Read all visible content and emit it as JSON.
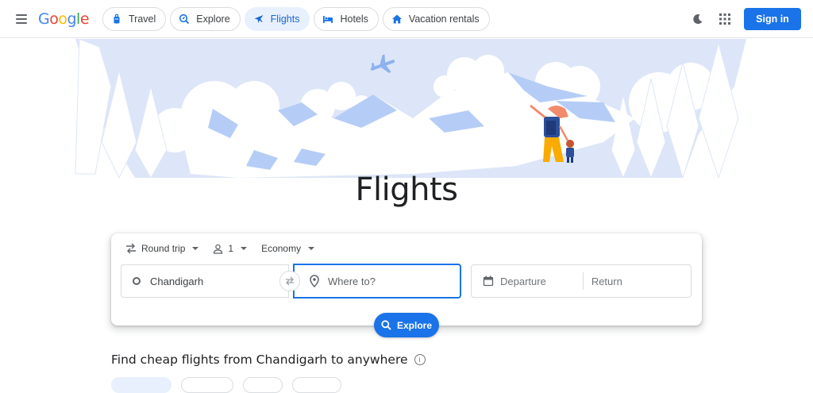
{
  "header": {
    "logo": {
      "letters": [
        "G",
        "o",
        "o",
        "g",
        "l",
        "e"
      ],
      "colors": [
        "#4285F4",
        "#EA4335",
        "#FBBC05",
        "#4285F4",
        "#34A853",
        "#EA4335"
      ]
    },
    "tabs": [
      {
        "label": "Travel",
        "icon": "suitcase-icon",
        "active": false
      },
      {
        "label": "Explore",
        "icon": "explore-icon",
        "active": false
      },
      {
        "label": "Flights",
        "icon": "plane-icon",
        "active": true
      },
      {
        "label": "Hotels",
        "icon": "bed-icon",
        "active": false
      },
      {
        "label": "Vacation rentals",
        "icon": "house-icon",
        "active": false
      }
    ],
    "signin_label": "Sign in"
  },
  "page": {
    "title": "Flights"
  },
  "search": {
    "trip_type": "Round trip",
    "passengers": "1",
    "cabin_class": "Economy",
    "from_value": "Chandigarh",
    "to_placeholder": "Where to?",
    "departure_placeholder": "Departure",
    "return_placeholder": "Return",
    "explore_label": "Explore"
  },
  "section": {
    "heading": "Find cheap flights from Chandigarh to anywhere",
    "info_glyph": "i"
  },
  "colors": {
    "accent": "#1a73e8",
    "active_chip_bg": "#e8f0fe",
    "active_chip_text": "#1967d2",
    "hero_sky": "#dde6f8"
  }
}
